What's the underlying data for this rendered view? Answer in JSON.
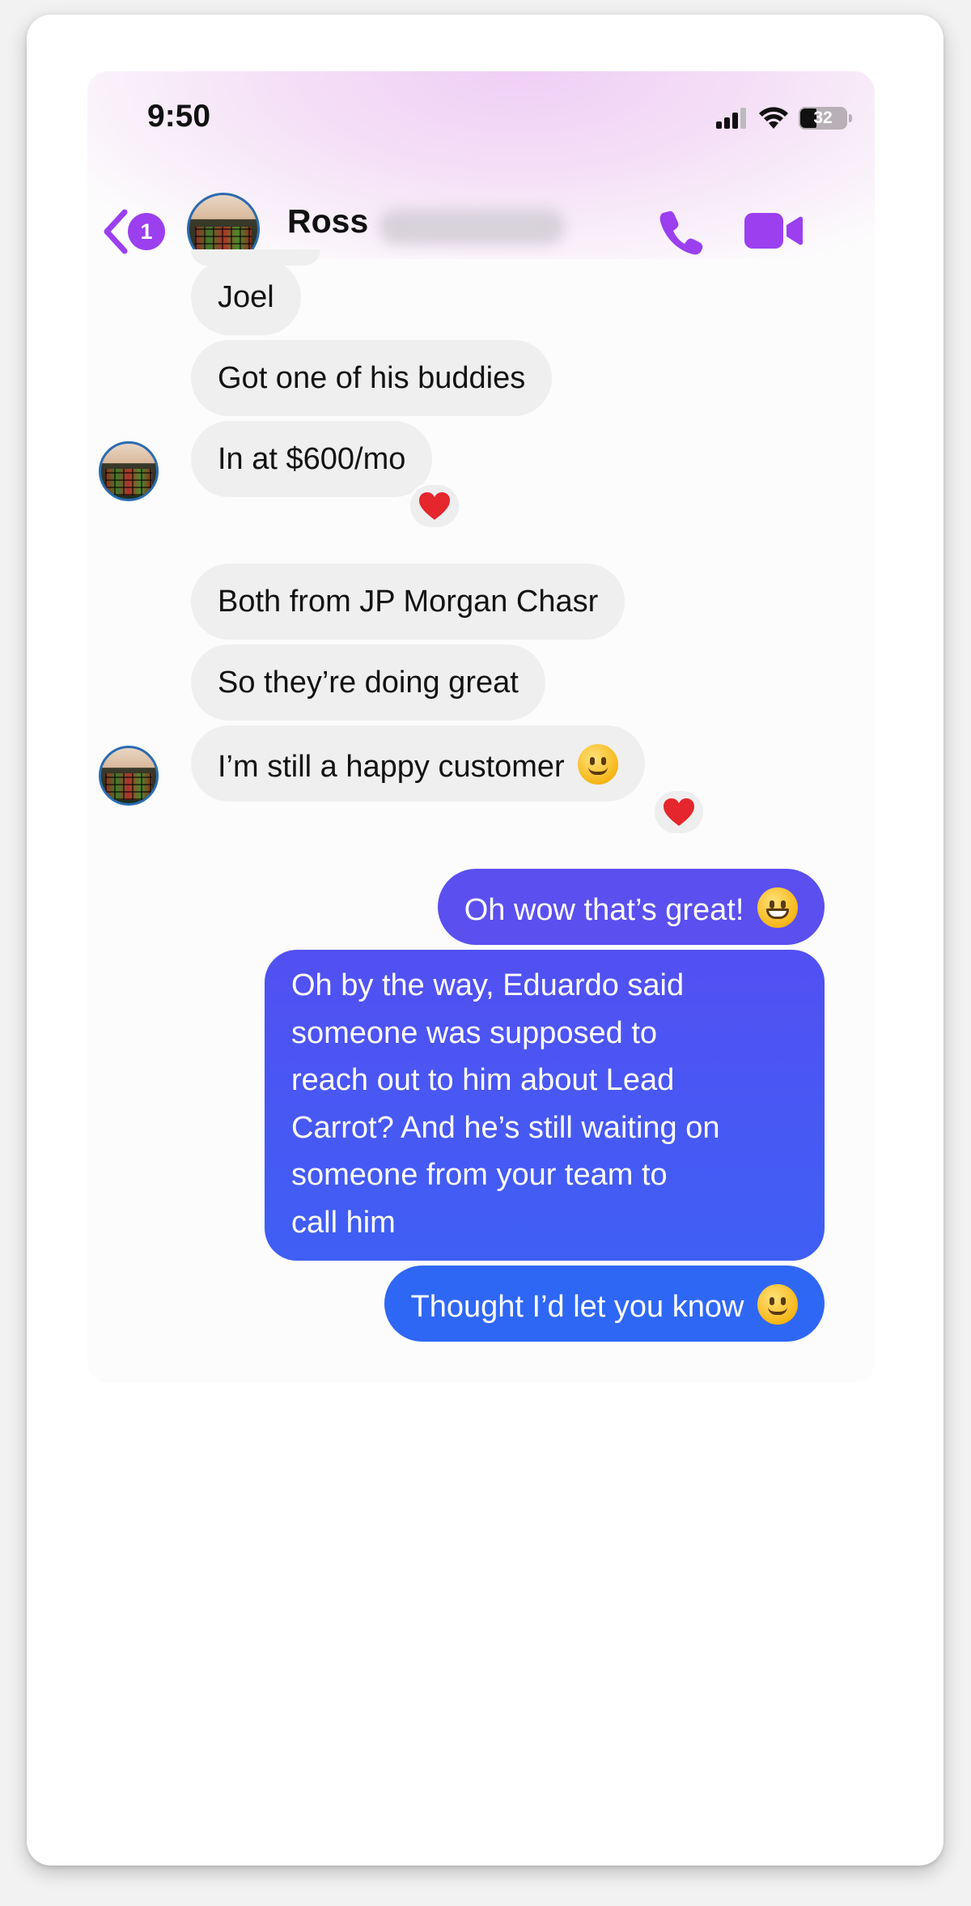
{
  "status": {
    "time": "9:50",
    "battery": "32"
  },
  "header": {
    "back_count": "1",
    "contact_name": "Ross"
  },
  "messages": [
    {
      "text": "Joel",
      "from": "them"
    },
    {
      "text": "Got one of his buddies",
      "from": "them"
    },
    {
      "text": "In at $600/mo",
      "from": "them",
      "reaction": "heart"
    },
    {
      "text": "Both from JP Morgan Chasr",
      "from": "them"
    },
    {
      "text": "So they’re doing great",
      "from": "them"
    },
    {
      "text": "I’m still a happy customer",
      "from": "them",
      "emoji": "slightly-smiling-face",
      "reaction": "heart"
    },
    {
      "text": "Oh wow that’s great!",
      "from": "me",
      "emoji": "grinning-face"
    },
    {
      "lines": [
        "Oh by the way, Eduardo said",
        "someone was supposed to",
        "reach out to him about Lead",
        "Carrot? And he’s still waiting on",
        "someone from your team to",
        "call him"
      ],
      "from": "me"
    },
    {
      "text": "Thought I’d let you know",
      "from": "me",
      "emoji": "slightly-smiling-face"
    }
  ],
  "colors": {
    "accent": "#9b3fef",
    "incoming_bubble": "#efefef",
    "outgoing_top": "#5b4ff0",
    "outgoing_bottom": "#2f67f5",
    "heart": "#e5262d"
  }
}
